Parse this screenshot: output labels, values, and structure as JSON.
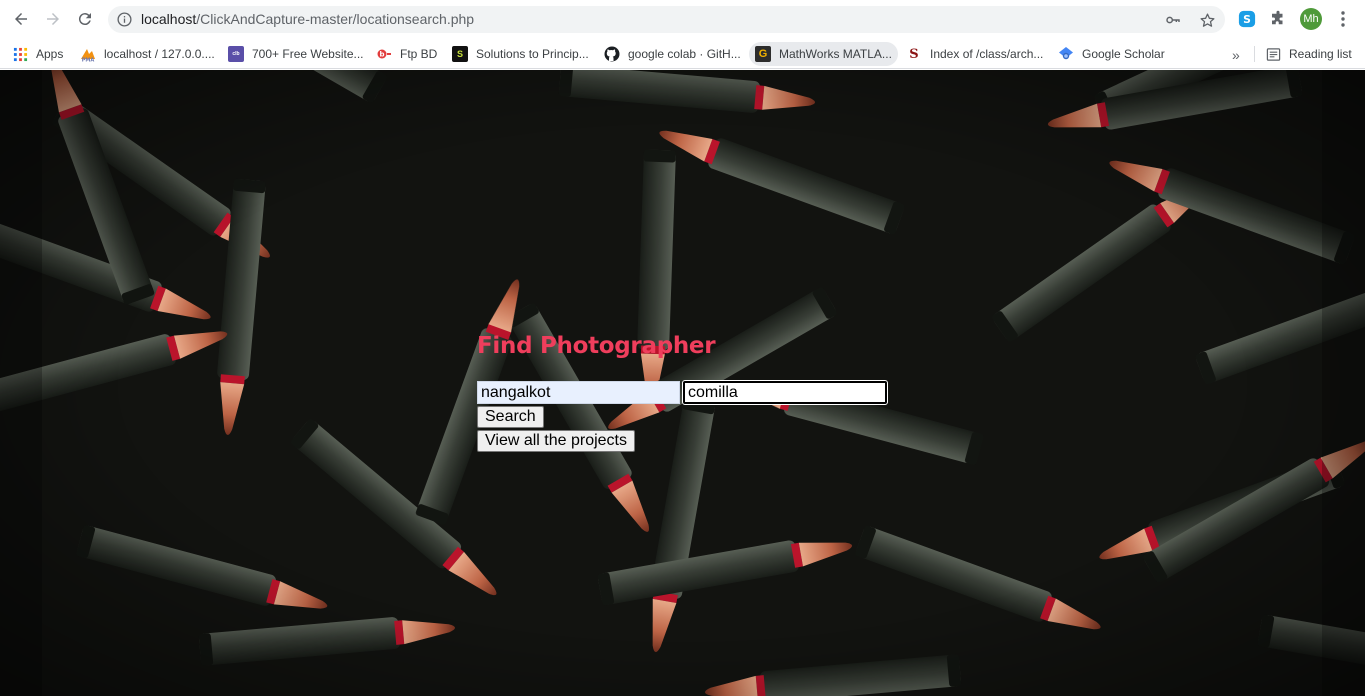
{
  "browser": {
    "url_host": "localhost",
    "url_path": "/ClickAndCapture-master/locationsearch.php",
    "profile_initials": "Mh",
    "bookmarks": [
      {
        "label": "Apps",
        "icon": "apps-grid-icon"
      },
      {
        "label": "localhost / 127.0.0....",
        "icon": "phpmyadmin-icon"
      },
      {
        "label": "700+ Free Website...",
        "icon": "colorlib-icon"
      },
      {
        "label": "Ftp BD",
        "icon": "ftpbd-icon"
      },
      {
        "label": "Solutions to Princip...",
        "icon": "solutions-icon"
      },
      {
        "label": "google colab · GitH...",
        "icon": "github-icon"
      },
      {
        "label": "MathWorks MATLA...",
        "icon": "mathworks-icon"
      },
      {
        "label": "Index of /class/arch...",
        "icon": "stanford-icon"
      },
      {
        "label": "Google Scholar",
        "icon": "scholar-icon"
      }
    ],
    "reading_list_label": "Reading list",
    "colors": {
      "accent_title": "#ef3e5c",
      "profile_avatar": "#4f9a3a"
    }
  },
  "page": {
    "title": "Find Photographer",
    "location_value": "nangalkot",
    "city_value": "comilla",
    "search_button": "Search",
    "projects_button": "View all the projects"
  }
}
